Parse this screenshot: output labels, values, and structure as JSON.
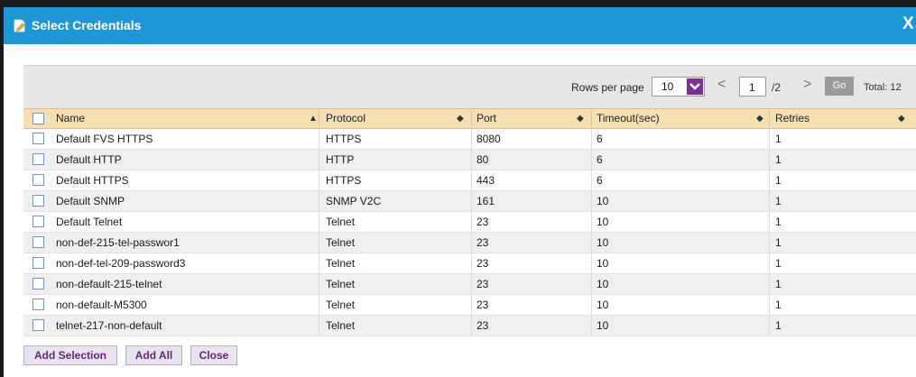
{
  "dialog": {
    "title": "Select Credentials",
    "close_glyph": "X"
  },
  "toolbar": {
    "rows_per_page_label": "Rows per page",
    "rows_per_page_value": "10",
    "prev_glyph": "<",
    "page_value": "1",
    "page_total": "/2",
    "next_glyph": ">",
    "go_label": "Go",
    "total_label": "Total: 12"
  },
  "table": {
    "columns": [
      "Name",
      "Protocol",
      "Port",
      "Timeout(sec)",
      "Retries"
    ],
    "rows": [
      [
        "Default FVS HTTPS",
        "HTTPS",
        "8080",
        "6",
        "1"
      ],
      [
        "Default HTTP",
        "HTTP",
        "80",
        "6",
        "1"
      ],
      [
        "Default HTTPS",
        "HTTPS",
        "443",
        "6",
        "1"
      ],
      [
        "Default SNMP",
        "SNMP V2C",
        "161",
        "10",
        "1"
      ],
      [
        "Default Telnet",
        "Telnet",
        "23",
        "10",
        "1"
      ],
      [
        "non-def-215-tel-passwor1",
        "Telnet",
        "23",
        "10",
        "1"
      ],
      [
        "non-def-tel-209-password3",
        "Telnet",
        "23",
        "10",
        "1"
      ],
      [
        "non-default-215-telnet",
        "Telnet",
        "23",
        "10",
        "1"
      ],
      [
        "non-default-M5300",
        "Telnet",
        "23",
        "10",
        "1"
      ],
      [
        "telnet-217-non-default",
        "Telnet",
        "23",
        "10",
        "1"
      ]
    ]
  },
  "buttons": {
    "add_selection": "Add Selection",
    "add_all": "Add All",
    "close": "Close"
  },
  "colors": {
    "titlebar": "#1f96d6",
    "header": "#f6dfb3",
    "accent": "#7b2f8e"
  }
}
